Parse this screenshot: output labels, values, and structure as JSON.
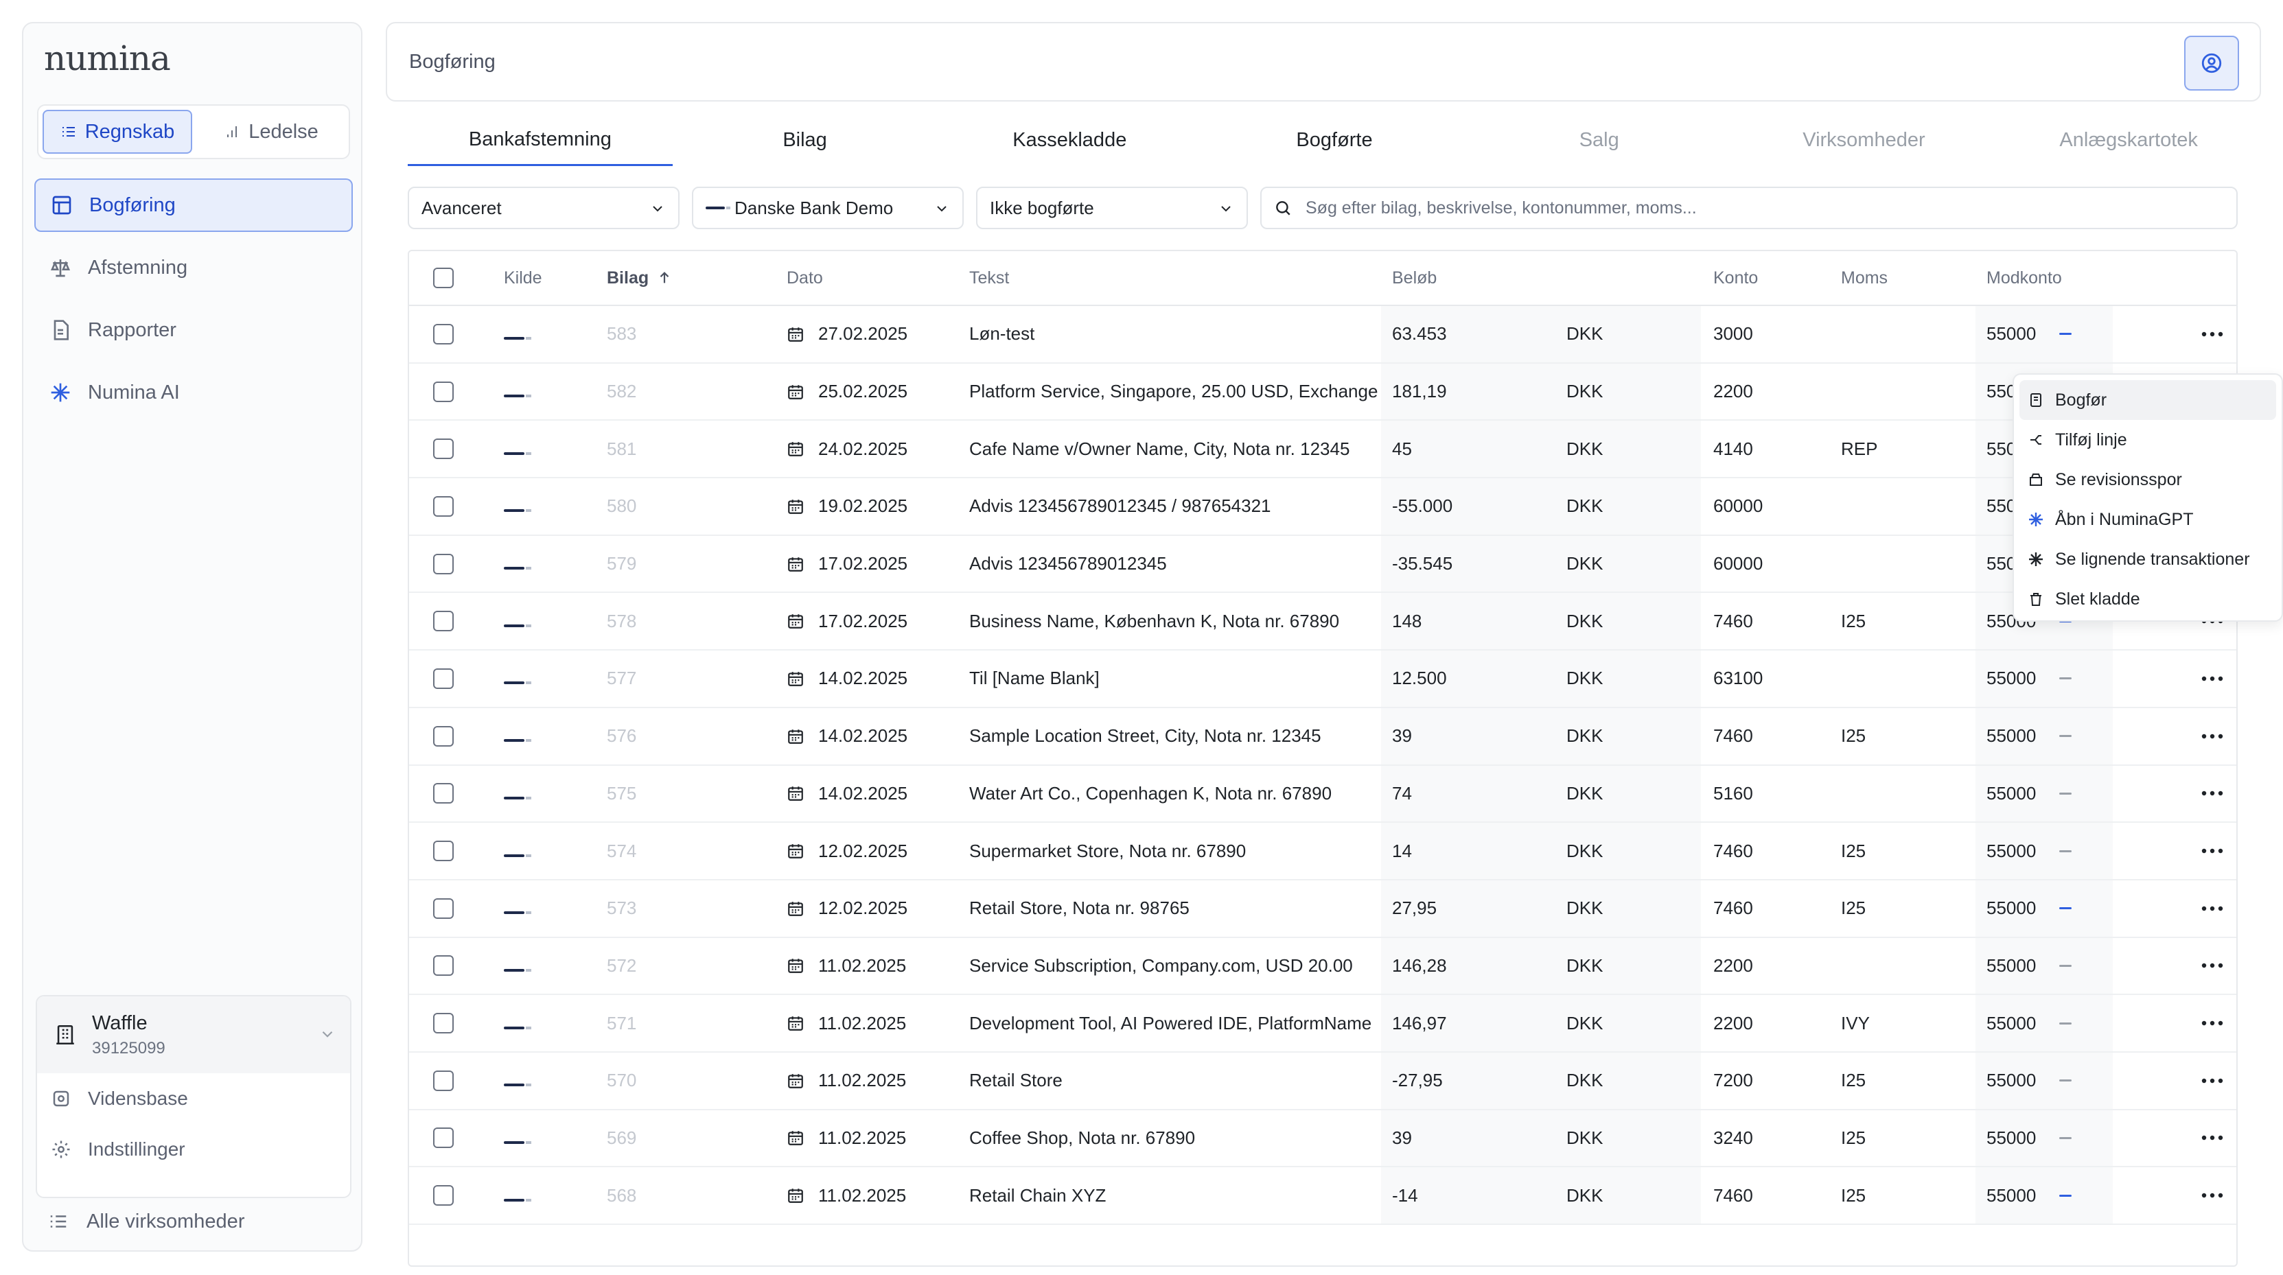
{
  "app": {
    "logo": "numina"
  },
  "sidebar": {
    "modes": [
      {
        "label": "Regnskab",
        "active": true
      },
      {
        "label": "Ledelse",
        "active": false
      }
    ],
    "nav": [
      {
        "label": "Bogføring",
        "icon": "table-icon",
        "active": true
      },
      {
        "label": "Afstemning",
        "icon": "scale-icon",
        "active": false
      },
      {
        "label": "Rapporter",
        "icon": "report-icon",
        "active": false
      },
      {
        "label": "Numina AI",
        "icon": "sparkle-icon",
        "active": false
      }
    ],
    "company": {
      "name": "Waffle",
      "id": "39125099"
    },
    "company_links": [
      {
        "label": "Vidensbase",
        "icon": "book-icon"
      },
      {
        "label": "Indstillinger",
        "icon": "gear-icon"
      }
    ],
    "all_companies": "Alle virksomheder"
  },
  "header": {
    "title": "Bogføring"
  },
  "tabs": [
    {
      "label": "Bankafstemning",
      "active": true,
      "disabled": false
    },
    {
      "label": "Bilag",
      "active": false,
      "disabled": false
    },
    {
      "label": "Kassekladde",
      "active": false,
      "disabled": false
    },
    {
      "label": "Bogførte",
      "active": false,
      "disabled": false
    },
    {
      "label": "Salg",
      "active": false,
      "disabled": true
    },
    {
      "label": "Virksomheder",
      "active": false,
      "disabled": true
    },
    {
      "label": "Anlægskartotek",
      "active": false,
      "disabled": true
    }
  ],
  "filters": {
    "mode": "Avanceret",
    "bank": "Danske Bank Demo",
    "status": "Ikke bogførte",
    "search_placeholder": "Søg efter bilag, beskrivelse, kontonummer, moms..."
  },
  "table": {
    "columns": {
      "kilde": "Kilde",
      "bilag": "Bilag",
      "dato": "Dato",
      "tekst": "Tekst",
      "belob": "Beløb",
      "konto": "Konto",
      "moms": "Moms",
      "modkonto": "Modkonto"
    },
    "rows": [
      {
        "bilag": "583",
        "dato": "27.02.2025",
        "tekst": "Løn-test",
        "belob": "63.453",
        "valuta": "DKK",
        "konto": "3000",
        "moms": "",
        "modkonto": "55000",
        "mark": "blue"
      },
      {
        "bilag": "582",
        "dato": "25.02.2025",
        "tekst": "Platform Service, Singapore, 25.00 USD, Exchange",
        "belob": "181,19",
        "valuta": "DKK",
        "konto": "2200",
        "moms": "",
        "modkonto": "55000",
        "mark": "gray"
      },
      {
        "bilag": "581",
        "dato": "24.02.2025",
        "tekst": "Cafe Name v/Owner Name, City, Nota nr. 12345",
        "belob": "45",
        "valuta": "DKK",
        "konto": "4140",
        "moms": "REP",
        "modkonto": "55000",
        "mark": "gray"
      },
      {
        "bilag": "580",
        "dato": "19.02.2025",
        "tekst": "Advis 123456789012345 / 987654321",
        "belob": "-55.000",
        "valuta": "DKK",
        "konto": "60000",
        "moms": "",
        "modkonto": "55000",
        "mark": "gray"
      },
      {
        "bilag": "579",
        "dato": "17.02.2025",
        "tekst": "Advis 123456789012345",
        "belob": "-35.545",
        "valuta": "DKK",
        "konto": "60000",
        "moms": "",
        "modkonto": "55000",
        "mark": "gray"
      },
      {
        "bilag": "578",
        "dato": "17.02.2025",
        "tekst": "Business Name, København K, Nota nr. 67890",
        "belob": "148",
        "valuta": "DKK",
        "konto": "7460",
        "moms": "I25",
        "modkonto": "55000",
        "mark": "blue"
      },
      {
        "bilag": "577",
        "dato": "14.02.2025",
        "tekst": "Til [Name Blank]",
        "belob": "12.500",
        "valuta": "DKK",
        "konto": "63100",
        "moms": "",
        "modkonto": "55000",
        "mark": "gray"
      },
      {
        "bilag": "576",
        "dato": "14.02.2025",
        "tekst": "Sample Location Street, City, Nota nr. 12345",
        "belob": "39",
        "valuta": "DKK",
        "konto": "7460",
        "moms": "I25",
        "modkonto": "55000",
        "mark": "gray"
      },
      {
        "bilag": "575",
        "dato": "14.02.2025",
        "tekst": "Water Art Co., Copenhagen K, Nota nr. 67890",
        "belob": "74",
        "valuta": "DKK",
        "konto": "5160",
        "moms": "",
        "modkonto": "55000",
        "mark": "gray"
      },
      {
        "bilag": "574",
        "dato": "12.02.2025",
        "tekst": "Supermarket Store, Nota nr. 67890",
        "belob": "14",
        "valuta": "DKK",
        "konto": "7460",
        "moms": "I25",
        "modkonto": "55000",
        "mark": "gray"
      },
      {
        "bilag": "573",
        "dato": "12.02.2025",
        "tekst": "Retail Store, Nota nr. 98765",
        "belob": "27,95",
        "valuta": "DKK",
        "konto": "7460",
        "moms": "I25",
        "modkonto": "55000",
        "mark": "blue"
      },
      {
        "bilag": "572",
        "dato": "11.02.2025",
        "tekst": "Service Subscription, Company.com, USD 20.00",
        "belob": "146,28",
        "valuta": "DKK",
        "konto": "2200",
        "moms": "",
        "modkonto": "55000",
        "mark": "gray"
      },
      {
        "bilag": "571",
        "dato": "11.02.2025",
        "tekst": "Development Tool, AI Powered IDE, PlatformName",
        "belob": "146,97",
        "valuta": "DKK",
        "konto": "2200",
        "moms": "IVY",
        "modkonto": "55000",
        "mark": "gray"
      },
      {
        "bilag": "570",
        "dato": "11.02.2025",
        "tekst": "Retail Store",
        "belob": "-27,95",
        "valuta": "DKK",
        "konto": "7200",
        "moms": "I25",
        "modkonto": "55000",
        "mark": "gray"
      },
      {
        "bilag": "569",
        "dato": "11.02.2025",
        "tekst": "Coffee Shop, Nota nr. 67890",
        "belob": "39",
        "valuta": "DKK",
        "konto": "3240",
        "moms": "I25",
        "modkonto": "55000",
        "mark": "gray"
      },
      {
        "bilag": "568",
        "dato": "11.02.2025",
        "tekst": "Retail Chain XYZ",
        "belob": "-14",
        "valuta": "DKK",
        "konto": "7460",
        "moms": "I25",
        "modkonto": "55000",
        "mark": "blue"
      }
    ]
  },
  "context_menu": [
    {
      "label": "Bogfør",
      "icon": "post-icon"
    },
    {
      "label": "Tilføj linje",
      "icon": "branch-icon"
    },
    {
      "label": "Se revisionsspor",
      "icon": "audit-icon"
    },
    {
      "label": "Åbn i NuminaGPT",
      "icon": "sparkle-icon"
    },
    {
      "label": "Se lignende transaktioner",
      "icon": "sparkle-dark-icon"
    },
    {
      "label": "Slet kladde",
      "icon": "trash-icon"
    }
  ],
  "colors": {
    "accent": "#2f5fe0",
    "accent_bg": "#e8eefc",
    "border": "#e7e9ec"
  }
}
